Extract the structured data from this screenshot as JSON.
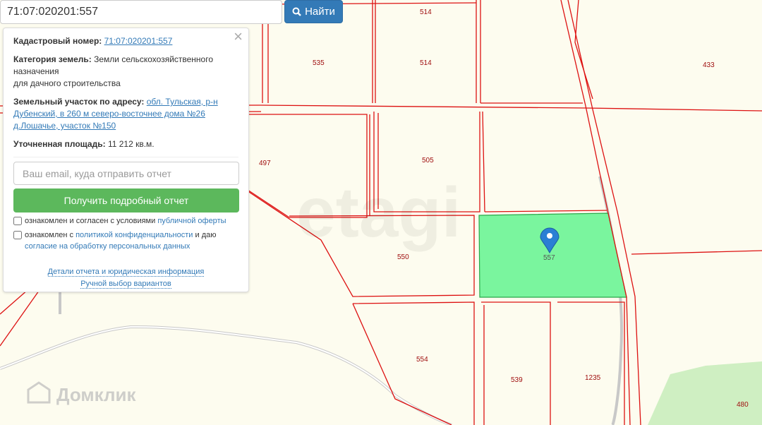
{
  "search": {
    "value": "71:07:020201:557",
    "button": "Найти"
  },
  "info": {
    "cad_label": "Кадастровый номер:",
    "cad_value": "71:07:020201:557",
    "cat_label": "Категория земель:",
    "cat_value": "Земли сельскохозяйственного назначения",
    "cat_value2": "для дачного строительства",
    "addr_label": "Земельный участок по адресу:",
    "addr_value": "обл. Тульская, р-н Дубенский, в 260 м северо-восточнее дома №26 д.Лошачье, участок №150",
    "area_label": "Уточненная площадь:",
    "area_value": "11 212 кв.м.",
    "email_placeholder": "Ваш email, куда отправить отчет",
    "report_button": "Получить подробный отчет",
    "check1_text": "ознакомлен и согласен с условиями",
    "check1_link": "публичной оферты",
    "check2_text": "ознакомлен с",
    "check2_link": "политикой конфиденциальности",
    "check2_text2": "и даю",
    "check2_link2": "согласие на обработку персональных данных",
    "details_link": "Детали отчета и юридическая информация",
    "manual_link": "Ручной выбор вариантов"
  },
  "map": {
    "parcels": [
      "514",
      "514",
      "535",
      "433",
      "497",
      "505",
      "550",
      "557",
      "554",
      "539",
      "1235",
      "480"
    ],
    "watermarks": [
      "etagi",
      "Домклик"
    ]
  }
}
